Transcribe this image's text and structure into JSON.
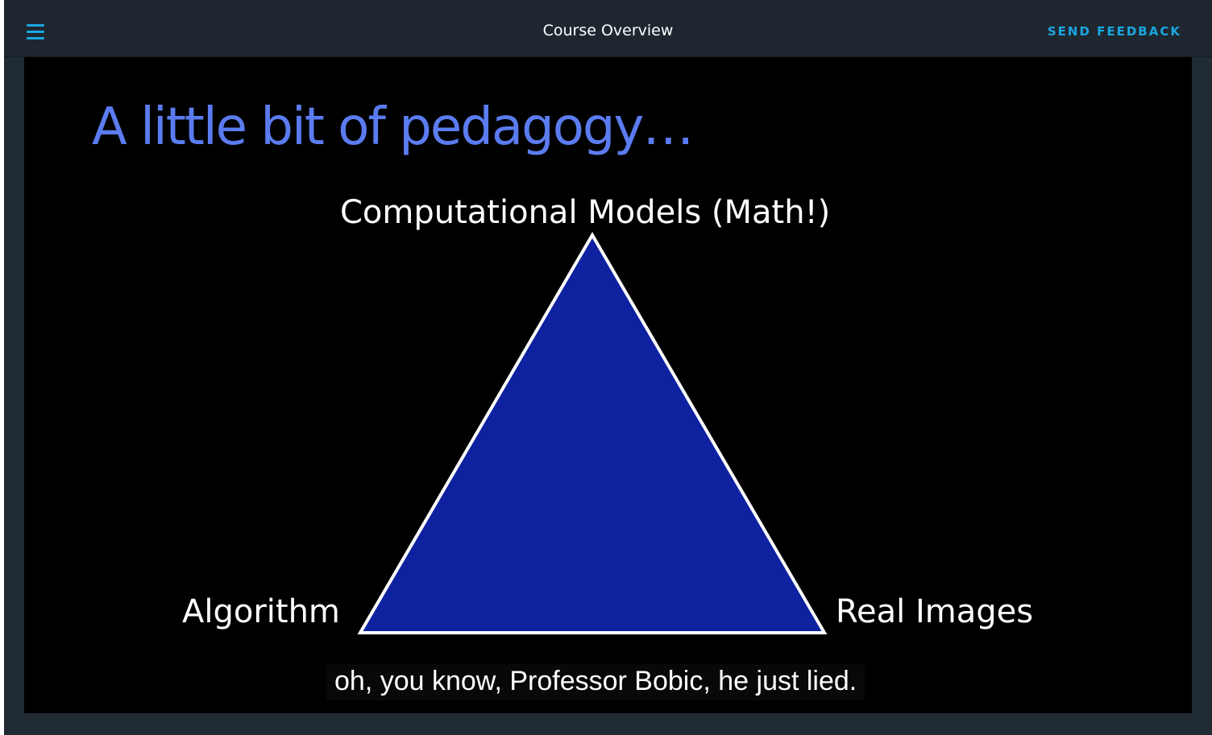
{
  "header": {
    "title": "Course Overview",
    "feedback_label": "SEND FEEDBACK",
    "menu_icon": "hamburger-menu-icon"
  },
  "video": {
    "slide_title": "A little bit of pedagogy…",
    "diagram": {
      "top_label": "Computational Models (Math!)",
      "left_label": "Algorithm",
      "right_label": "Real Images",
      "triangle_fill": "#0e22a0",
      "triangle_stroke": "#ffffff"
    },
    "caption": "oh, you know, Professor Bobic, he just lied."
  },
  "colors": {
    "header_bg": "#1e2730",
    "accent": "#1aa7e0",
    "slide_title": "#5b7cf0"
  }
}
